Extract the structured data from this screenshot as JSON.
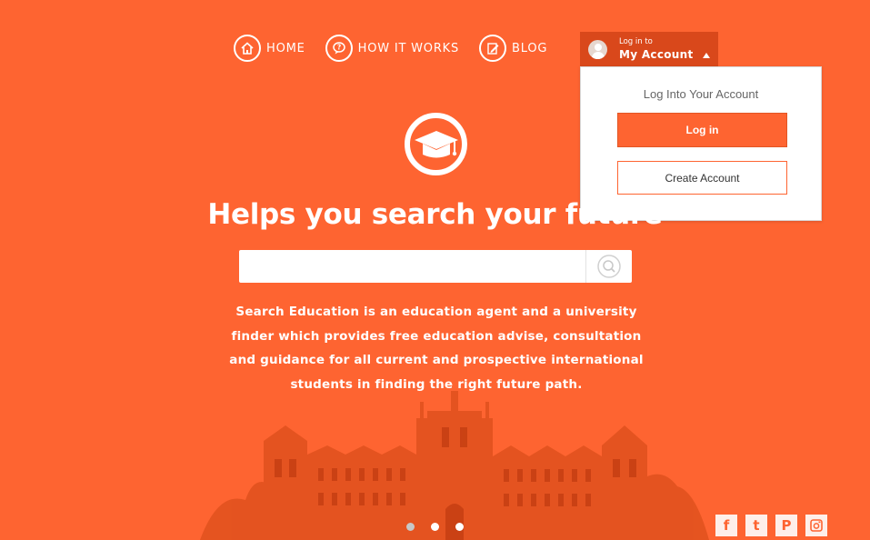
{
  "nav": {
    "items": [
      {
        "label": "HOME",
        "icon": "home-icon"
      },
      {
        "label": "HOW IT WORKS",
        "icon": "question-icon"
      },
      {
        "label": "BLOG",
        "icon": "edit-icon"
      }
    ]
  },
  "account": {
    "small_label": "Log in to",
    "big_label": "My Account",
    "dropdown": {
      "title": "Log Into Your Account",
      "login_label": "Log in",
      "create_label": "Create Account"
    }
  },
  "hero": {
    "headline": "Helps you search your future",
    "search_placeholder": "",
    "description": "Search Education is an education agent and a university finder which provides free education advise, consultation and guidance for all current and prospective international students in finding the right future path."
  },
  "carousel": {
    "count": 3,
    "active_index": 0
  },
  "social": [
    {
      "name": "facebook-icon",
      "glyph": "f"
    },
    {
      "name": "twitter-icon",
      "glyph": "t"
    },
    {
      "name": "pinterest-icon",
      "glyph": "P"
    },
    {
      "name": "instagram-icon",
      "glyph": ""
    }
  ],
  "colors": {
    "brand": "#fe6431",
    "account_bg": "#d9481b"
  }
}
